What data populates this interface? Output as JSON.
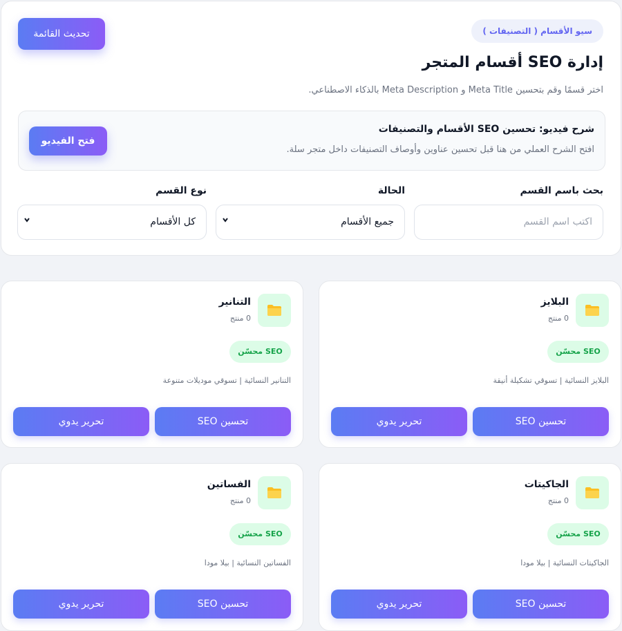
{
  "header": {
    "badge": "سيو الأقسام ( التصنيفات )",
    "refresh_label": "تحديث القائمة",
    "title": "إدارة SEO أقسام المتجر",
    "subtitle": "اختر قسمًا وقم بتحسين Meta Title و Meta Description بالذكاء الاصطناعي."
  },
  "video": {
    "title": "شرح فيديو: تحسين SEO الأقسام والتصنيفات",
    "description": "افتح الشرح العملي من هنا قبل تحسين عناوين وأوصاف التصنيفات داخل متجر سلة.",
    "button_label": "فتح الفيديو"
  },
  "filters": {
    "search": {
      "label": "بحث باسم القسم",
      "placeholder": "اكتب اسم القسم"
    },
    "status": {
      "label": "الحالة",
      "value": "جميع الأقسام"
    },
    "type": {
      "label": "نوع القسم",
      "value": "كل الأقسام"
    }
  },
  "categories": [
    {
      "name": "البلايز",
      "count": "0 منتج",
      "badge": "SEO محسّن",
      "description": "البلايز النسائية | تسوقي تشكيلة أنيقة",
      "seo_button": "تحسين SEO",
      "manual_button": "تحرير يدوي"
    },
    {
      "name": "التنانير",
      "count": "0 منتج",
      "badge": "SEO محسّن",
      "description": "التنانير النسائية | تسوقي موديلات متنوعة",
      "seo_button": "تحسين SEO",
      "manual_button": "تحرير يدوي"
    },
    {
      "name": "الجاكيتات",
      "count": "0 منتج",
      "badge": "SEO محسّن",
      "description": "الجاكيتات النسائية | بيلا مودا",
      "seo_button": "تحسين SEO",
      "manual_button": "تحرير يدوي"
    },
    {
      "name": "الفساتين",
      "count": "0 منتج",
      "badge": "SEO محسّن",
      "description": "الفساتين النسائية | بيلا مودا",
      "seo_button": "تحسين SEO",
      "manual_button": "تحرير يدوي"
    }
  ],
  "colors": {
    "accent_start": "#5b7cf3",
    "accent_end": "#8b5cf6",
    "success_bg": "#dcfce7",
    "success_text": "#16a34a",
    "folder": "#fbbf24"
  },
  "icons": {
    "folder": "folder-icon",
    "chevron": "chevron-down-icon"
  }
}
